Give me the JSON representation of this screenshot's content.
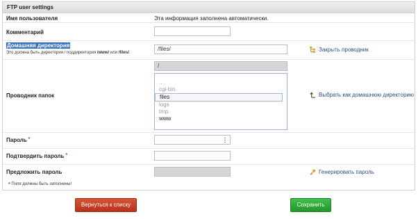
{
  "panel": {
    "title": "FTP user settings"
  },
  "fields": {
    "username": {
      "label": "Имя пользователя",
      "value": "Эта информация заполнена автоматически."
    },
    "comment": {
      "label": "Комментарий",
      "value": ""
    },
    "home_dir": {
      "label": "Домашняя директория",
      "hint_prefix": "Это должна быть директория / поддиректория ",
      "hint_www": "/www/",
      "hint_or": " или ",
      "hint_files": "/files/",
      "hint_end": ".",
      "value": "/files/",
      "action": "Закрыть проводник"
    },
    "explorer": {
      "label": "Проводник папок",
      "path": "/",
      "items": [
        {
          "name": "..",
          "state": "dim"
        },
        {
          "name": "cgi-bin",
          "state": "dim"
        },
        {
          "name": "files",
          "state": "selected"
        },
        {
          "name": "logs",
          "state": "dim"
        },
        {
          "name": "tmp",
          "state": "dim"
        },
        {
          "name": "www",
          "state": "active"
        }
      ],
      "action": "Выбрать как домашнюю директорию"
    },
    "password": {
      "label": "Пароль",
      "required": "*",
      "value": ""
    },
    "confirm": {
      "label": "Подтвердить пароль",
      "required": "*",
      "value": ""
    },
    "suggest": {
      "label": "Предложить пароль",
      "value": "",
      "action": "Генерировать пароль"
    }
  },
  "required_note": {
    "star": "*",
    "text": "Поля должны быть заполнены!"
  },
  "buttons": {
    "back": "Вернуться к списку",
    "save": "Сохранить"
  },
  "colors": {
    "back": "#c8402a",
    "save": "#2ea838",
    "link": "#2a4a8a"
  }
}
